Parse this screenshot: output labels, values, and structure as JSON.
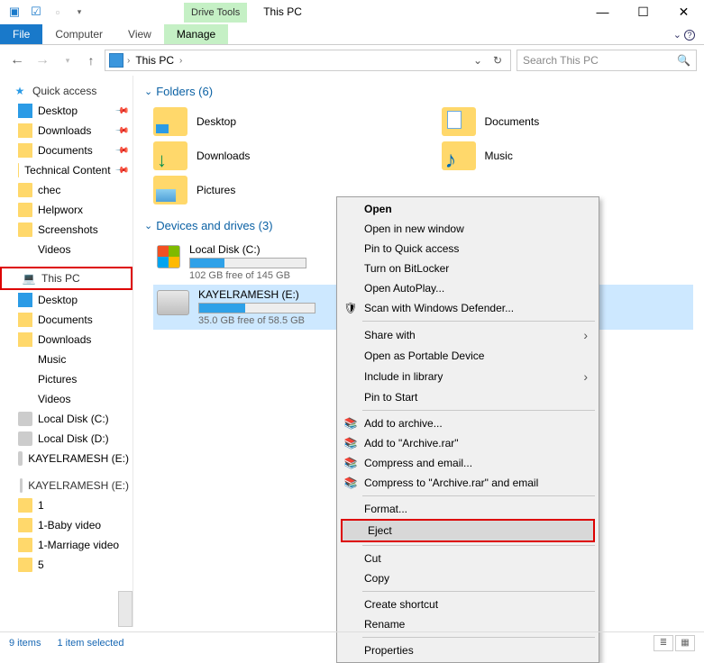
{
  "title": "This PC",
  "drive_tools_label": "Drive Tools",
  "ribbon": {
    "file": "File",
    "computer": "Computer",
    "view": "View",
    "manage": "Manage"
  },
  "address": {
    "root": "This PC"
  },
  "search": {
    "placeholder": "Search This PC"
  },
  "sidebar": {
    "quick_access": "Quick access",
    "pinned": [
      {
        "label": "Desktop"
      },
      {
        "label": "Downloads"
      },
      {
        "label": "Documents"
      },
      {
        "label": "Technical Content"
      },
      {
        "label": "chec"
      },
      {
        "label": "Helpworx"
      },
      {
        "label": "Screenshots"
      },
      {
        "label": "Videos"
      }
    ],
    "this_pc": "This PC",
    "pc_items": [
      {
        "label": "Desktop"
      },
      {
        "label": "Documents"
      },
      {
        "label": "Downloads"
      },
      {
        "label": "Music"
      },
      {
        "label": "Pictures"
      },
      {
        "label": "Videos"
      },
      {
        "label": "Local Disk (C:)"
      },
      {
        "label": "Local Disk (D:)"
      },
      {
        "label": "KAYELRAMESH (E:)"
      }
    ],
    "ext_drive": "KAYELRAMESH (E:)",
    "ext_items": [
      {
        "label": "1"
      },
      {
        "label": "1-Baby video"
      },
      {
        "label": "1-Marriage video"
      },
      {
        "label": "5"
      }
    ]
  },
  "main": {
    "folders_header": "Folders (6)",
    "folders": [
      {
        "label": "Desktop"
      },
      {
        "label": "Documents"
      },
      {
        "label": "Downloads"
      },
      {
        "label": "Music"
      },
      {
        "label": "Pictures"
      }
    ],
    "drives_header": "Devices and drives (3)",
    "drives": [
      {
        "label": "Local Disk (C:)",
        "free": "102 GB free of 145 GB",
        "fill": 30
      },
      {
        "label": "KAYELRAMESH (E:)",
        "free": "35.0 GB free of 58.5 GB",
        "fill": 40
      }
    ]
  },
  "context_menu": [
    {
      "label": "Open",
      "bold": true
    },
    {
      "label": "Open in new window"
    },
    {
      "label": "Pin to Quick access"
    },
    {
      "label": "Turn on BitLocker"
    },
    {
      "label": "Open AutoPlay..."
    },
    {
      "label": "Scan with Windows Defender...",
      "icon": "shield"
    },
    {
      "sep": true
    },
    {
      "label": "Share with",
      "sub": true
    },
    {
      "label": "Open as Portable Device"
    },
    {
      "label": "Include in library",
      "sub": true
    },
    {
      "label": "Pin to Start"
    },
    {
      "sep": true
    },
    {
      "label": "Add to archive...",
      "icon": "rar"
    },
    {
      "label": "Add to \"Archive.rar\"",
      "icon": "rar"
    },
    {
      "label": "Compress and email...",
      "icon": "rar"
    },
    {
      "label": "Compress to \"Archive.rar\" and email",
      "icon": "rar"
    },
    {
      "sep": true
    },
    {
      "label": "Format..."
    },
    {
      "label": "Eject",
      "highlight": true,
      "hover": true
    },
    {
      "sep": true
    },
    {
      "label": "Cut"
    },
    {
      "label": "Copy"
    },
    {
      "sep": true
    },
    {
      "label": "Create shortcut"
    },
    {
      "label": "Rename"
    },
    {
      "sep": true
    },
    {
      "label": "Properties"
    }
  ],
  "status": {
    "items": "9 items",
    "selected": "1 item selected"
  }
}
